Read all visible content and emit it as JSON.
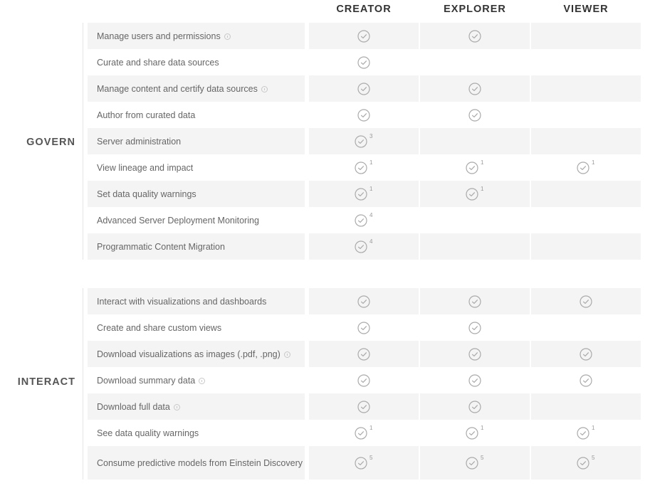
{
  "columns": [
    "CREATOR",
    "EXPLORER",
    "VIEWER"
  ],
  "icons": {
    "check": "check-circle-icon",
    "info": "info-icon"
  },
  "colors": {
    "stripe": "#f4f4f4",
    "check": "#aaaaaa",
    "text": "#666666",
    "heading": "#333333"
  },
  "sections": [
    {
      "label": "GOVERN",
      "rows": [
        {
          "feature": "Manage users and permissions",
          "info": true,
          "creator": {
            "check": true,
            "note": ""
          },
          "explorer": {
            "check": true,
            "note": ""
          },
          "viewer": {
            "check": false,
            "note": ""
          }
        },
        {
          "feature": "Curate and share data sources",
          "info": false,
          "creator": {
            "check": true,
            "note": ""
          },
          "explorer": {
            "check": false,
            "note": ""
          },
          "viewer": {
            "check": false,
            "note": ""
          }
        },
        {
          "feature": "Manage content and certify data sources",
          "info": true,
          "creator": {
            "check": true,
            "note": ""
          },
          "explorer": {
            "check": true,
            "note": ""
          },
          "viewer": {
            "check": false,
            "note": ""
          }
        },
        {
          "feature": "Author from curated data",
          "info": false,
          "creator": {
            "check": true,
            "note": ""
          },
          "explorer": {
            "check": true,
            "note": ""
          },
          "viewer": {
            "check": false,
            "note": ""
          }
        },
        {
          "feature": "Server administration",
          "info": false,
          "creator": {
            "check": true,
            "note": "3"
          },
          "explorer": {
            "check": false,
            "note": ""
          },
          "viewer": {
            "check": false,
            "note": ""
          }
        },
        {
          "feature": "View lineage and impact",
          "info": false,
          "creator": {
            "check": true,
            "note": "1"
          },
          "explorer": {
            "check": true,
            "note": "1"
          },
          "viewer": {
            "check": true,
            "note": "1"
          }
        },
        {
          "feature": "Set data quality warnings",
          "info": false,
          "creator": {
            "check": true,
            "note": "1"
          },
          "explorer": {
            "check": true,
            "note": "1"
          },
          "viewer": {
            "check": false,
            "note": ""
          }
        },
        {
          "feature": "Advanced Server Deployment Monitoring",
          "info": false,
          "creator": {
            "check": true,
            "note": "4"
          },
          "explorer": {
            "check": false,
            "note": ""
          },
          "viewer": {
            "check": false,
            "note": ""
          }
        },
        {
          "feature": "Programmatic Content Migration",
          "info": false,
          "creator": {
            "check": true,
            "note": "4"
          },
          "explorer": {
            "check": false,
            "note": ""
          },
          "viewer": {
            "check": false,
            "note": ""
          }
        }
      ]
    },
    {
      "label": "INTERACT",
      "rows": [
        {
          "feature": "Interact with visualizations and dashboards",
          "info": false,
          "creator": {
            "check": true,
            "note": ""
          },
          "explorer": {
            "check": true,
            "note": ""
          },
          "viewer": {
            "check": true,
            "note": ""
          }
        },
        {
          "feature": "Create and share custom views",
          "info": false,
          "creator": {
            "check": true,
            "note": ""
          },
          "explorer": {
            "check": true,
            "note": ""
          },
          "viewer": {
            "check": false,
            "note": ""
          }
        },
        {
          "feature": "Download visualizations as images (.pdf, .png)",
          "info": true,
          "creator": {
            "check": true,
            "note": ""
          },
          "explorer": {
            "check": true,
            "note": ""
          },
          "viewer": {
            "check": true,
            "note": ""
          }
        },
        {
          "feature": "Download summary data",
          "info": true,
          "creator": {
            "check": true,
            "note": ""
          },
          "explorer": {
            "check": true,
            "note": ""
          },
          "viewer": {
            "check": true,
            "note": ""
          }
        },
        {
          "feature": "Download full data",
          "info": true,
          "creator": {
            "check": true,
            "note": ""
          },
          "explorer": {
            "check": true,
            "note": ""
          },
          "viewer": {
            "check": false,
            "note": ""
          }
        },
        {
          "feature": "See data quality warnings",
          "info": false,
          "creator": {
            "check": true,
            "note": "1"
          },
          "explorer": {
            "check": true,
            "note": "1"
          },
          "viewer": {
            "check": true,
            "note": "1"
          }
        },
        {
          "feature": "Consume predictive models from Einstein Discovery",
          "info": false,
          "creator": {
            "check": true,
            "note": "5"
          },
          "explorer": {
            "check": true,
            "note": "5"
          },
          "viewer": {
            "check": true,
            "note": "5"
          }
        }
      ]
    }
  ]
}
